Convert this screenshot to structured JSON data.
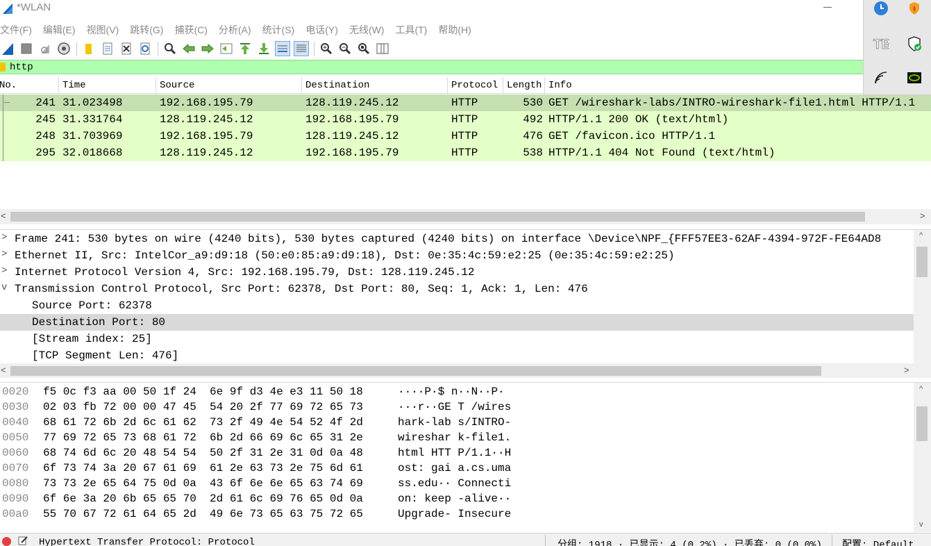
{
  "window": {
    "title": "*WLAN"
  },
  "menu": [
    "文件(F)",
    "编辑(E)",
    "视图(V)",
    "跳转(G)",
    "捕获(C)",
    "分析(A)",
    "统计(S)",
    "电话(Y)",
    "无线(W)",
    "工具(T)",
    "帮助(H)"
  ],
  "toolbar": {
    "icons": [
      "start-capture-icon",
      "stop-capture-icon",
      "restart-capture-icon",
      "capture-options-icon",
      "open-file-icon",
      "save-file-icon",
      "close-file-icon",
      "reload-file-icon",
      "find-packet-icon",
      "go-back-icon",
      "go-forward-icon",
      "go-to-packet-icon",
      "go-first-icon",
      "go-last-icon",
      "auto-scroll-icon",
      "colorize-icon",
      "zoom-in-icon",
      "zoom-out-icon",
      "zoom-normal-icon",
      "resize-columns-icon"
    ]
  },
  "filter": {
    "value": "http"
  },
  "packet_list": {
    "columns": [
      "No.",
      "Time",
      "Source",
      "Destination",
      "Protocol",
      "Length",
      "Info"
    ],
    "rows": [
      {
        "no": "241",
        "time": "31.023498",
        "source": "192.168.195.79",
        "destination": "128.119.245.12",
        "protocol": "HTTP",
        "length": "530",
        "info": "GET /wireshark-labs/INTRO-wireshark-file1.html HTTP/1.1",
        "selected": true
      },
      {
        "no": "245",
        "time": "31.331764",
        "source": "128.119.245.12",
        "destination": "192.168.195.79",
        "protocol": "HTTP",
        "length": "492",
        "info": "HTTP/1.1 200 OK  (text/html)"
      },
      {
        "no": "248",
        "time": "31.703969",
        "source": "192.168.195.79",
        "destination": "128.119.245.12",
        "protocol": "HTTP",
        "length": "476",
        "info": "GET /favicon.ico HTTP/1.1"
      },
      {
        "no": "295",
        "time": "32.018668",
        "source": "128.119.245.12",
        "destination": "192.168.195.79",
        "protocol": "HTTP",
        "length": "538",
        "info": "HTTP/1.1 404 Not Found  (text/html)"
      }
    ],
    "row_color": "#e4ffc7",
    "selected_color": "#c5dfb0"
  },
  "details": [
    {
      "caret": ">",
      "indent": 0,
      "text": "Frame 241: 530 bytes on wire (4240 bits), 530 bytes captured (4240 bits) on interface \\Device\\NPF_{FFF57EE3-62AF-4394-972F-FE64AD8"
    },
    {
      "caret": ">",
      "indent": 0,
      "text": "Ethernet II, Src: IntelCor_a9:d9:18 (50:e0:85:a9:d9:18), Dst: 0e:35:4c:59:e2:25 (0e:35:4c:59:e2:25)"
    },
    {
      "caret": ">",
      "indent": 0,
      "text": "Internet Protocol Version 4, Src: 192.168.195.79, Dst: 128.119.245.12"
    },
    {
      "caret": "v",
      "indent": 0,
      "text": "Transmission Control Protocol, Src Port: 62378, Dst Port: 80, Seq: 1, Ack: 1, Len: 476"
    },
    {
      "caret": "",
      "indent": 1,
      "text": "Source Port: 62378"
    },
    {
      "caret": "",
      "indent": 1,
      "text": "Destination Port: 80",
      "selected": true
    },
    {
      "caret": "",
      "indent": 1,
      "text": "[Stream index: 25]"
    },
    {
      "caret": "",
      "indent": 1,
      "text": "[TCP Segment Len: 476]"
    }
  ],
  "bytes": [
    {
      "offset": "0020",
      "hex1": "f5 0c f3 aa 00 50 1f 24",
      "hex2": "6e 9f d3 4e e3 11 50 18",
      "ascii1": "····P·$",
      "ascii2": "n··N··P·"
    },
    {
      "offset": "0030",
      "hex1": "02 03 fb 72 00 00 47 45",
      "hex2": "54 20 2f 77 69 72 65 73",
      "ascii1": "···r··GE",
      "ascii2": "T /wires"
    },
    {
      "offset": "0040",
      "hex1": "68 61 72 6b 2d 6c 61 62",
      "hex2": "73 2f 49 4e 54 52 4f 2d",
      "ascii1": "hark-lab",
      "ascii2": "s/INTRO-"
    },
    {
      "offset": "0050",
      "hex1": "77 69 72 65 73 68 61 72",
      "hex2": "6b 2d 66 69 6c 65 31 2e",
      "ascii1": "wireshar",
      "ascii2": "k-file1."
    },
    {
      "offset": "0060",
      "hex1": "68 74 6d 6c 20 48 54 54",
      "hex2": "50 2f 31 2e 31 0d 0a 48",
      "ascii1": "html HTT",
      "ascii2": "P/1.1··H"
    },
    {
      "offset": "0070",
      "hex1": "6f 73 74 3a 20 67 61 69",
      "hex2": "61 2e 63 73 2e 75 6d 61",
      "ascii1": "ost: gai",
      "ascii2": "a.cs.uma"
    },
    {
      "offset": "0080",
      "hex1": "73 73 2e 65 64 75 0d 0a",
      "hex2": "43 6f 6e 6e 65 63 74 69",
      "ascii1": "ss.edu··",
      "ascii2": "Connecti"
    },
    {
      "offset": "0090",
      "hex1": "6f 6e 3a 20 6b 65 65 70",
      "hex2": "2d 61 6c 69 76 65 0d 0a",
      "ascii1": "on: keep",
      "ascii2": "-alive··"
    },
    {
      "offset": "00a0",
      "hex1": "55 70 67 72 61 64 65 2d",
      "hex2": "49 6e 73 65 63 75 72 65",
      "ascii1": "Upgrade-",
      "ascii2": "Insecure"
    }
  ],
  "status": {
    "field": "Hypertext Transfer Protocol: Protocol",
    "packets": "分组: 1918 · 已显示: 4 (0.2%) · 已丢弃: 0 (0.0%)",
    "profile": "配置: Default"
  },
  "tray": {
    "icons": [
      "clock-icon",
      "security-flame-icon",
      "tb-app-icon",
      "defender-shield-icon",
      "wifi-icon",
      "nvidia-icon"
    ]
  }
}
